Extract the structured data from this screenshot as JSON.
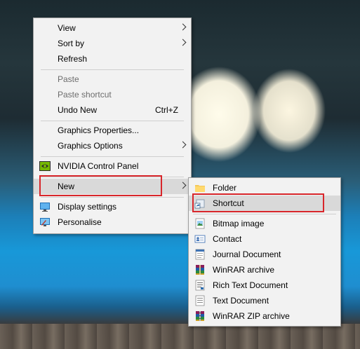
{
  "context_menu": {
    "items": [
      {
        "label": "View"
      },
      {
        "label": "Sort by"
      },
      {
        "label": "Refresh"
      },
      {
        "label": "Paste"
      },
      {
        "label": "Paste shortcut"
      },
      {
        "label": "Undo New",
        "shortcut": "Ctrl+Z"
      },
      {
        "label": "Graphics Properties..."
      },
      {
        "label": "Graphics Options"
      },
      {
        "label": "NVIDIA Control Panel",
        "icon": "nvidia-icon"
      },
      {
        "label": "New"
      },
      {
        "label": "Display settings",
        "icon": "display-icon"
      },
      {
        "label": "Personalise",
        "icon": "personalise-icon"
      }
    ]
  },
  "new_submenu": {
    "items": [
      {
        "label": "Folder",
        "icon": "folder-icon"
      },
      {
        "label": "Shortcut",
        "icon": "shortcut-icon"
      },
      {
        "label": "Bitmap image",
        "icon": "bitmap-icon"
      },
      {
        "label": "Contact",
        "icon": "contact-icon"
      },
      {
        "label": "Journal Document",
        "icon": "journal-icon"
      },
      {
        "label": "WinRAR archive",
        "icon": "winrar-icon"
      },
      {
        "label": "Rich Text Document",
        "icon": "rtf-icon"
      },
      {
        "label": "Text Document",
        "icon": "text-document-icon"
      },
      {
        "label": "WinRAR ZIP archive",
        "icon": "winrar-zip-icon"
      }
    ]
  },
  "colors": {
    "highlight": "#d9d9d9",
    "annotation_box": "#d8262b",
    "menu_background": "#f2f2f2"
  }
}
